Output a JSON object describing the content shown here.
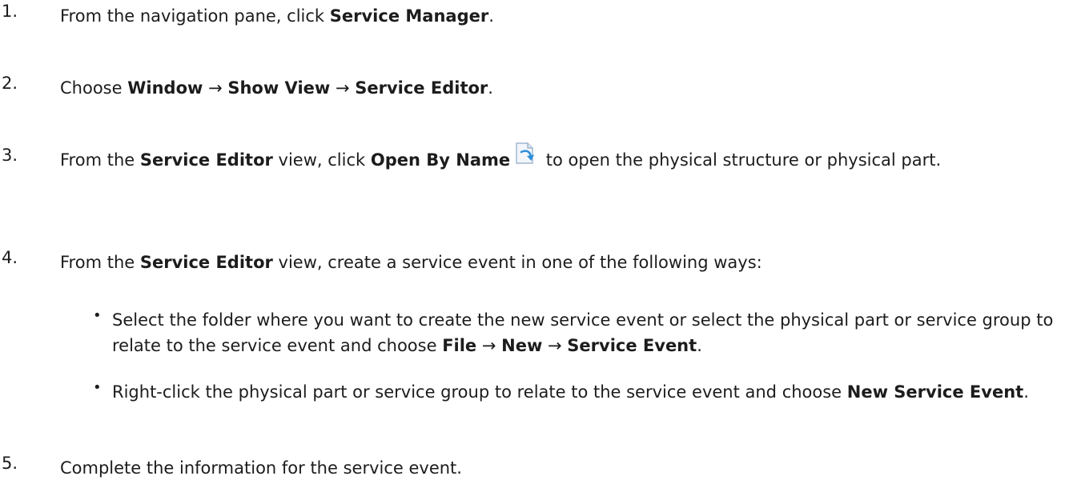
{
  "steps": [
    {
      "num": "1.",
      "pre": "From the navigation pane, click ",
      "b1": "Service Manager",
      "post": "."
    },
    {
      "num": "2.",
      "pre": "Choose ",
      "b1": "Window",
      "a1": " → ",
      "b2": "Show View",
      "a2": " → ",
      "b3": "Service Editor",
      "post": "."
    },
    {
      "num": "3.",
      "pre": "From the ",
      "b1": "Service Editor",
      "mid1": " view, click ",
      "b2": "Open By Name",
      "post": " to open the physical structure or physical part.",
      "icon": "open-by-name-icon"
    },
    {
      "num": "4.",
      "pre": "From the ",
      "b1": "Service Editor",
      "post": " view, create a service event in one of the following ways:"
    },
    {
      "num": "5.",
      "text": "Complete the information for the service event."
    }
  ],
  "bullets": [
    {
      "mark": "•",
      "pre": "Select the folder where you want to create the new service event or select the physical part or service group to relate to the service event and choose ",
      "b1": "File",
      "a1": " → ",
      "b2": "New",
      "a2": " → ",
      "b3": "Service Event",
      "post": "."
    },
    {
      "mark": "•",
      "pre": "Right-click the physical part or service group to relate to the service event and choose ",
      "b1": "New Service Event",
      "post": "."
    }
  ]
}
